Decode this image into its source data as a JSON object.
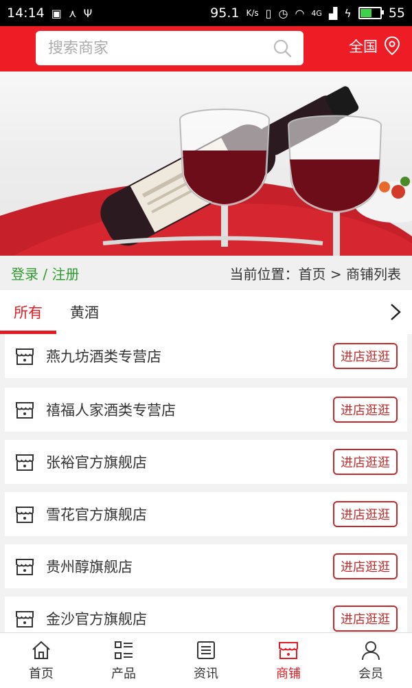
{
  "status_bar": {
    "time": "14:14",
    "speed": "95.1",
    "speed_unit": "K/s",
    "network": "4G",
    "battery": "55"
  },
  "header": {
    "search_placeholder": "搜索商家",
    "region_label": "全国"
  },
  "location_bar": {
    "login_label": "登录 / 注册",
    "breadcrumb": "当前位置：首页 > 商铺列表"
  },
  "tabs": [
    {
      "label": "所有",
      "active": true
    },
    {
      "label": "黄酒",
      "active": false
    }
  ],
  "shops": [
    {
      "name": "燕九坊酒类专营店",
      "button": "进店逛逛"
    },
    {
      "name": "禧福人家酒类专营店",
      "button": "进店逛逛"
    },
    {
      "name": "张裕官方旗舰店",
      "button": "进店逛逛"
    },
    {
      "name": "雪花官方旗舰店",
      "button": "进店逛逛"
    },
    {
      "name": "贵州醇旗舰店",
      "button": "进店逛逛"
    },
    {
      "name": "金沙官方旗舰店",
      "button": "进店逛逛"
    }
  ],
  "bottom_nav": [
    {
      "label": "首页",
      "icon": "home-icon",
      "active": false
    },
    {
      "label": "产品",
      "icon": "product-grid-icon",
      "active": false
    },
    {
      "label": "资讯",
      "icon": "news-icon",
      "active": false
    },
    {
      "label": "商铺",
      "icon": "shop-icon",
      "active": true
    },
    {
      "label": "会员",
      "icon": "user-icon",
      "active": false
    }
  ],
  "colors": {
    "brand_red": "#ee1c25",
    "active_red": "#e01b22",
    "login_green": "#2e9b2e",
    "button_red": "#c22a2a"
  }
}
